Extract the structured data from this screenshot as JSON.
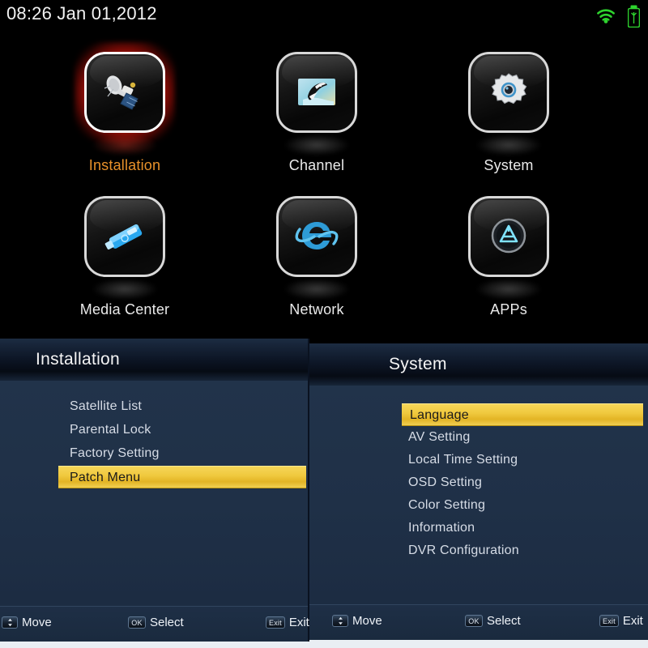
{
  "statusbar": {
    "clock": "08:26 Jan 01,2012",
    "wifi_icon": "wifi-icon",
    "usb_icon": "usb-drive-icon",
    "icon_color": "#2ed32e"
  },
  "main_menu": {
    "selected": "Installation",
    "selected_color": "#e8912a",
    "label_color": "#eaeaea",
    "items": [
      {
        "label": "Installation",
        "icon": "satellite-icon",
        "selected": true
      },
      {
        "label": "Channel",
        "icon": "tv-orca-icon",
        "selected": false
      },
      {
        "label": "System",
        "icon": "gear-icon",
        "selected": false
      },
      {
        "label": "Media Center",
        "icon": "usb-flash-icon",
        "selected": false
      },
      {
        "label": "Network",
        "icon": "browser-e-icon",
        "selected": false
      },
      {
        "label": "APPs",
        "icon": "app-store-icon",
        "selected": false
      }
    ]
  },
  "installation_panel": {
    "title": "Installation",
    "items": [
      {
        "label": "Satellite List",
        "highlighted": false
      },
      {
        "label": "Parental Lock",
        "highlighted": false
      },
      {
        "label": "Factory Setting",
        "highlighted": false
      },
      {
        "label": "Patch Menu",
        "highlighted": true
      }
    ],
    "footer": [
      {
        "key": "arrows",
        "label": "Move"
      },
      {
        "key": "OK",
        "label": "Select"
      },
      {
        "key": "Exit",
        "label": "Exit"
      }
    ]
  },
  "system_panel": {
    "title": "System",
    "items": [
      {
        "label": "Language",
        "highlighted": true
      },
      {
        "label": "AV Setting",
        "highlighted": false
      },
      {
        "label": "Local Time Setting",
        "highlighted": false
      },
      {
        "label": "OSD Setting",
        "highlighted": false
      },
      {
        "label": "Color Setting",
        "highlighted": false
      },
      {
        "label": "Information",
        "highlighted": false
      },
      {
        "label": "DVR Configuration",
        "highlighted": false
      }
    ],
    "footer": [
      {
        "key": "arrows",
        "label": "Move"
      },
      {
        "key": "OK",
        "label": "Select"
      },
      {
        "key": "Exit",
        "label": "Exit"
      }
    ]
  },
  "theme": {
    "highlight_yellow": "#f0c93f",
    "panel_blue": "#1f3047",
    "background": "#000000"
  }
}
